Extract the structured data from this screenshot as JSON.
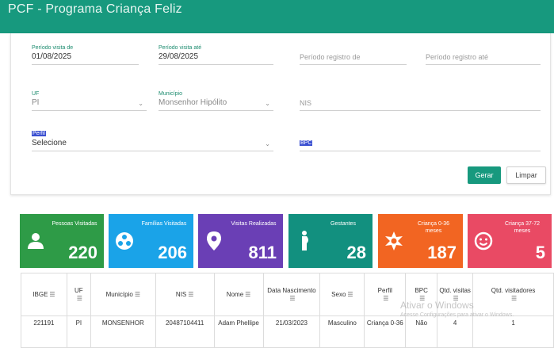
{
  "header": {
    "title": "PCF - Programa Criança Feliz"
  },
  "filters": {
    "periodo_visita_de": {
      "label": "Período visita de",
      "value": "01/08/2025"
    },
    "periodo_visita_ate": {
      "label": "Período visita até",
      "value": "29/08/2025"
    },
    "periodo_registro_de": {
      "placeholder": "Período registro de"
    },
    "periodo_registro_ate": {
      "placeholder": "Período registro até"
    },
    "uf": {
      "label": "UF",
      "value": "PI"
    },
    "municipio": {
      "label": "Município",
      "value": "Monsenhor Hipólito"
    },
    "nis": {
      "placeholder": "NIS"
    },
    "perfil": {
      "label": "Perfil",
      "value": "Selecione"
    },
    "bpc": {
      "placeholder": "BPC"
    }
  },
  "actions": {
    "gerar": "Gerar",
    "limpar": "Limpar"
  },
  "stats": [
    {
      "label": "Pessoas Visitadas",
      "value": "220",
      "color": "#2e9b47",
      "icon": "person-icon"
    },
    {
      "label": "Famílias Visitadas",
      "value": "206",
      "color": "#1aa3e8",
      "icon": "family-icon"
    },
    {
      "label": "Visitas Realizadas",
      "value": "811",
      "color": "#6a3fb5",
      "icon": "map-pin-icon"
    },
    {
      "label": "Gestantes",
      "value": "28",
      "color": "#12907f",
      "icon": "pregnant-icon"
    },
    {
      "label": "Criança 0-36 meses",
      "value": "187",
      "color": "#f26522",
      "icon": "toy-icon"
    },
    {
      "label": "Criança 37-72 meses",
      "value": "5",
      "color": "#e94a64",
      "icon": "child-face-icon"
    }
  ],
  "table": {
    "headers": [
      "IBGE",
      "UF",
      "Município",
      "NIS",
      "Nome",
      "Data Nascimento",
      "Sexo",
      "Perfil",
      "BPC",
      "Qtd. visitas",
      "Qtd. visitadores"
    ],
    "row": [
      "221191",
      "PI",
      "MONSENHOR",
      "20487104411",
      "Adam Phellipe",
      "21/03/2023",
      "Masculino",
      "Criança 0-36",
      "Não",
      "4",
      "1"
    ]
  },
  "watermark": {
    "line1": "Ativar o Windows",
    "line2": "Acesse Configurações para ativar o Windows."
  }
}
